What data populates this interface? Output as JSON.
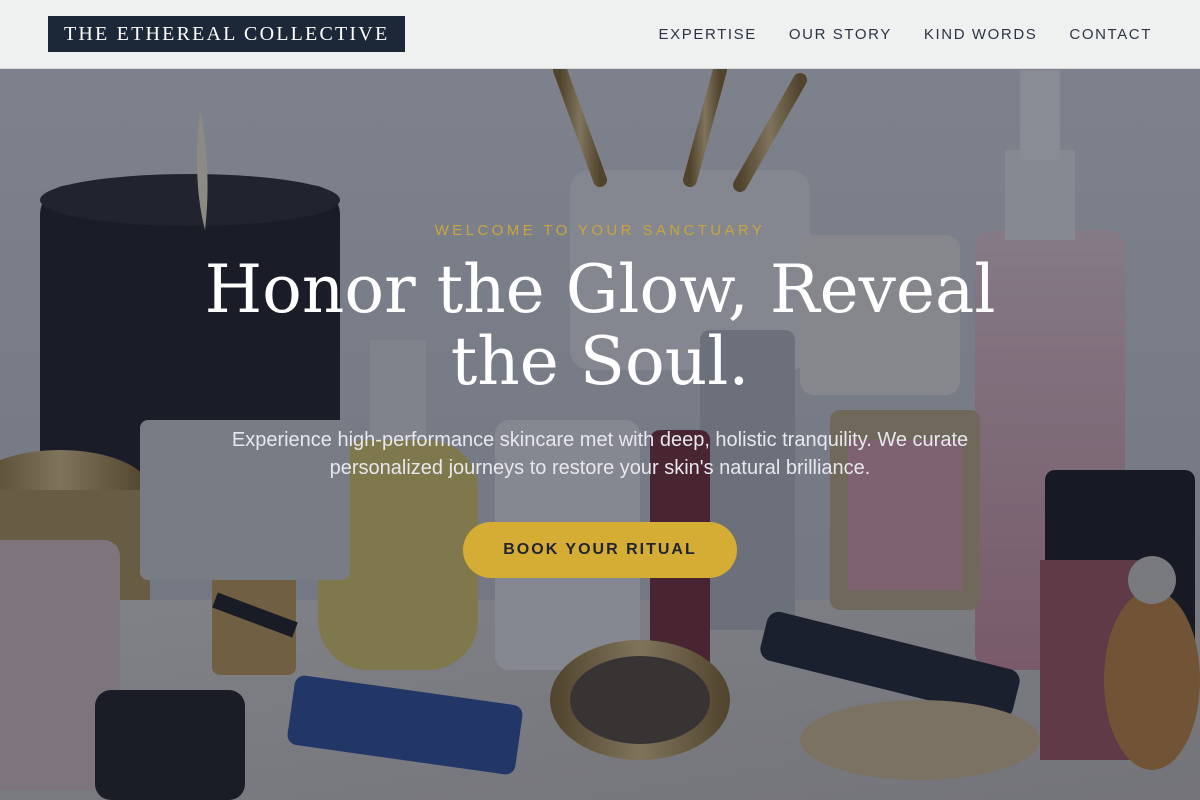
{
  "header": {
    "brand": "THE ETHEREAL COLLECTIVE",
    "nav": [
      {
        "label": "EXPERTISE"
      },
      {
        "label": "OUR STORY"
      },
      {
        "label": "KIND WORDS"
      },
      {
        "label": "CONTACT"
      }
    ]
  },
  "hero": {
    "eyebrow": "WELCOME TO YOUR SANCTUARY",
    "headline": "Honor the Glow, Reveal the Soul.",
    "lede": "Experience high-performance skincare met with deep, holistic tranquility. We curate personalized journeys to restore your skin's natural brilliance.",
    "cta_label": "BOOK YOUR RITUAL",
    "background_image": "vanity table with skincare and makeup products"
  },
  "colors": {
    "brand_bg": "#1c2738",
    "accent_gold": "#d6ad34",
    "eyebrow_gold": "#c9a53e",
    "overlay": "#181e2e"
  }
}
